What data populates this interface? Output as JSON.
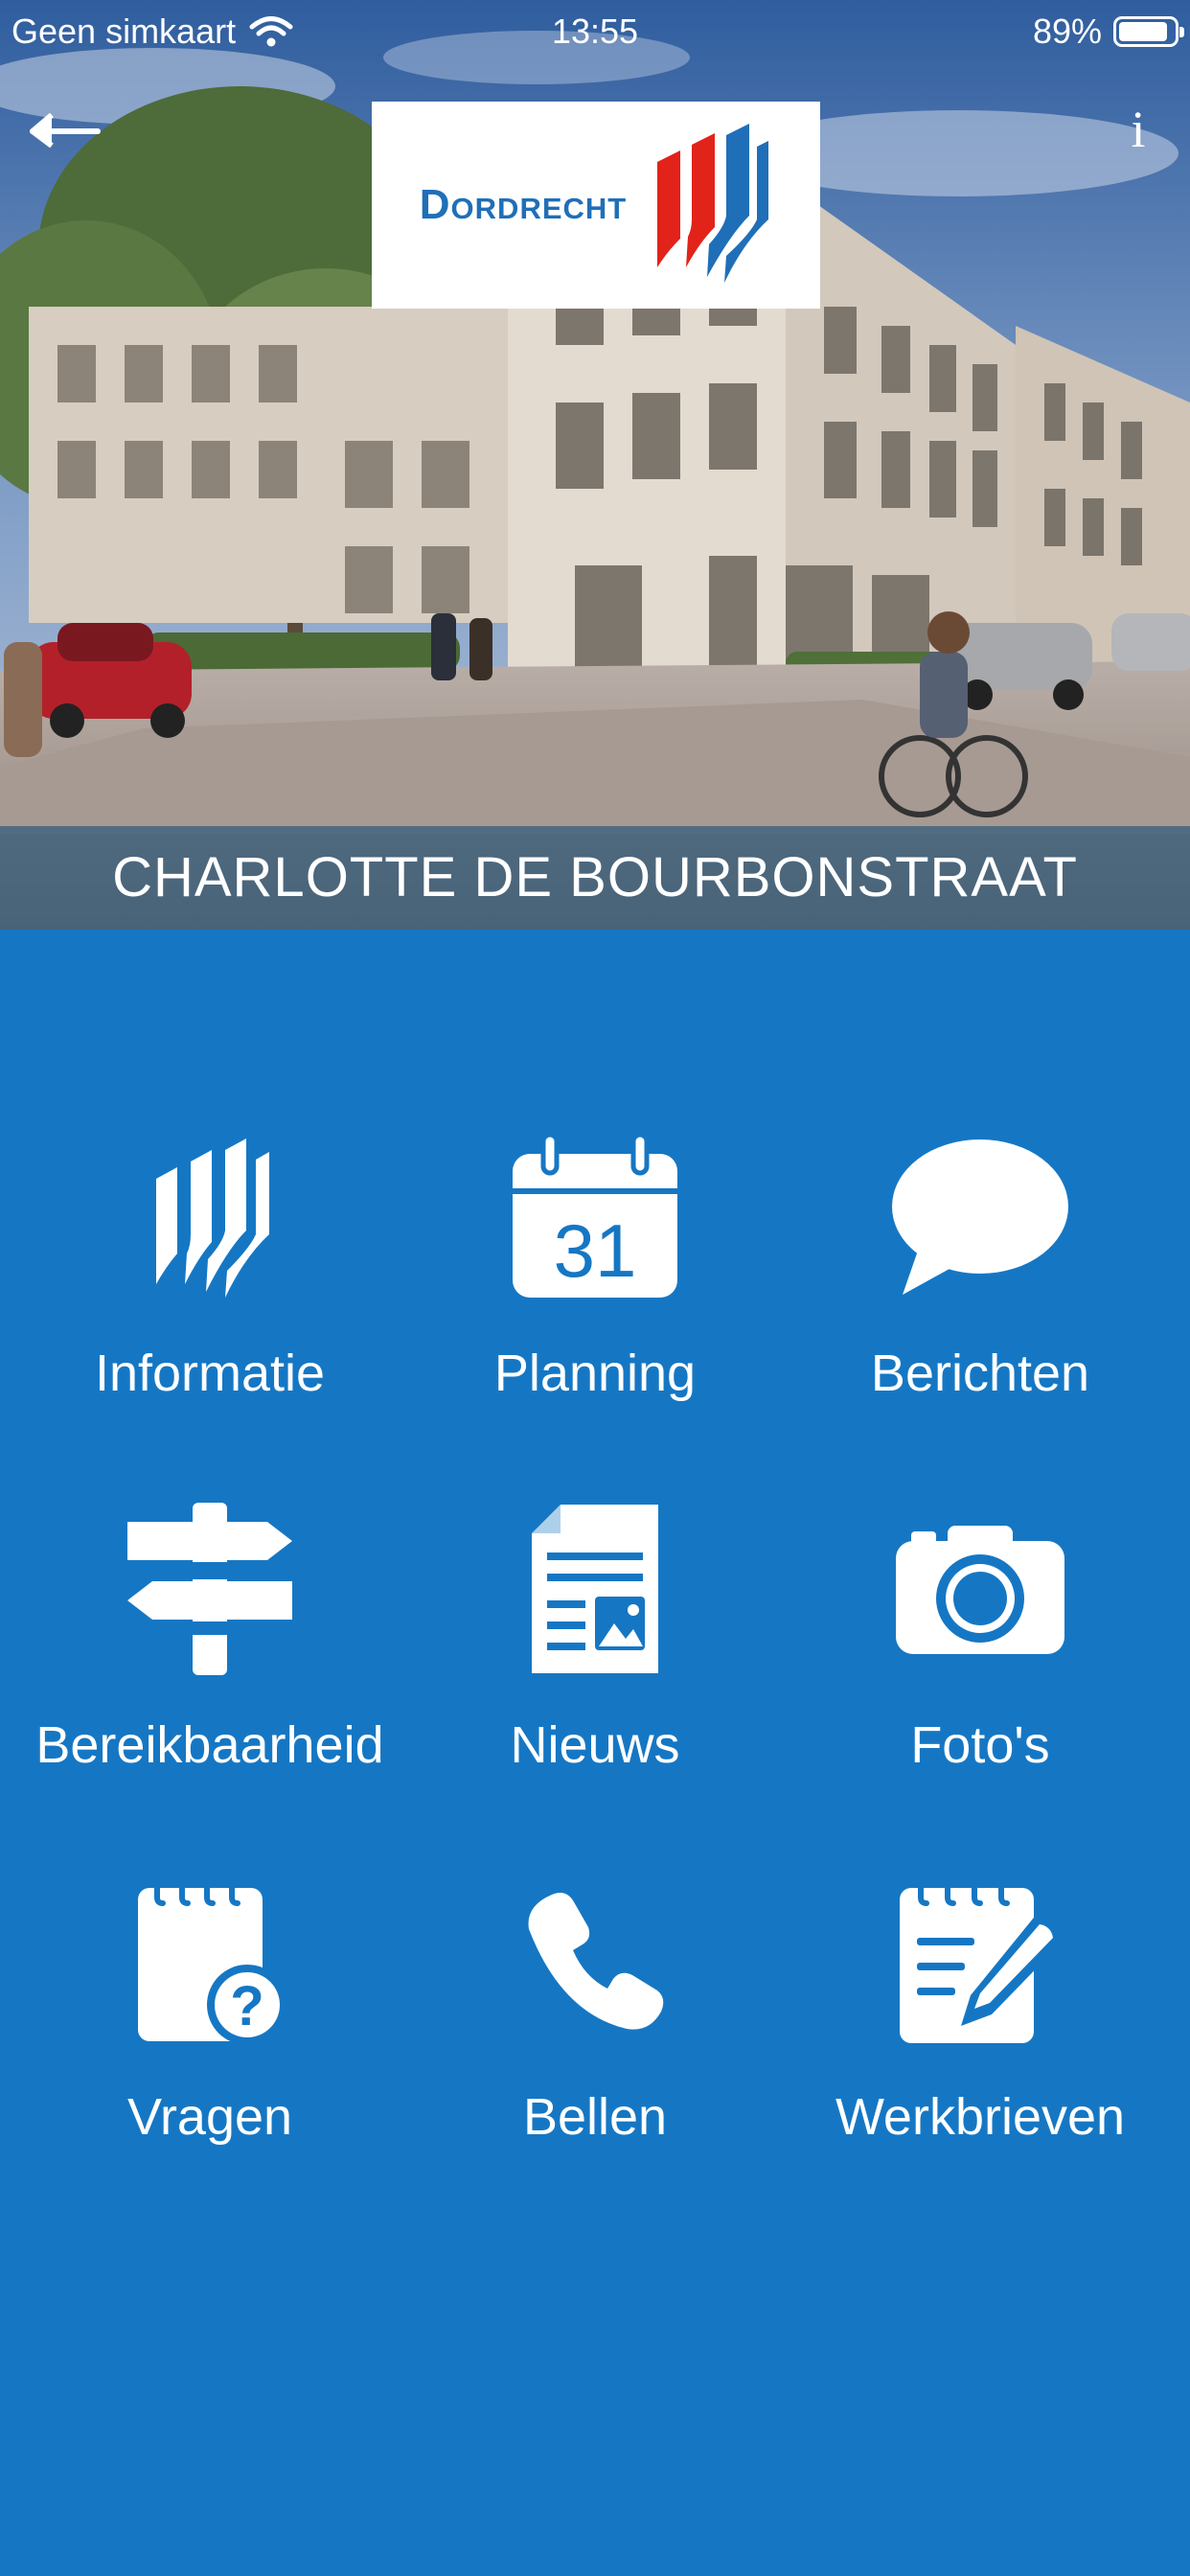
{
  "status": {
    "carrier": "Geen simkaart",
    "time": "13:55",
    "battery": "89%",
    "battery_level": 0.89
  },
  "header": {
    "logo_text": "Dordrecht",
    "info_label": "i",
    "title": "CHARLOTTE DE BOURBONSTRAAT"
  },
  "menu": {
    "items": [
      {
        "label": "Informatie",
        "icon": "dordrecht-logo-icon"
      },
      {
        "label": "Planning",
        "icon": "calendar-icon",
        "icon_text": "31"
      },
      {
        "label": "Berichten",
        "icon": "chat-bubble-icon"
      },
      {
        "label": "Bereikbaarheid",
        "icon": "signpost-icon"
      },
      {
        "label": "Nieuws",
        "icon": "newspaper-icon"
      },
      {
        "label": "Foto's",
        "icon": "camera-icon"
      },
      {
        "label": "Vragen",
        "icon": "question-notepad-icon"
      },
      {
        "label": "Bellen",
        "icon": "phone-icon"
      },
      {
        "label": "Werkbrieven",
        "icon": "notepad-pen-icon"
      }
    ]
  },
  "colors": {
    "background": "#1577c4",
    "logo_blue": "#1f6fb8",
    "logo_red": "#e2231a"
  }
}
